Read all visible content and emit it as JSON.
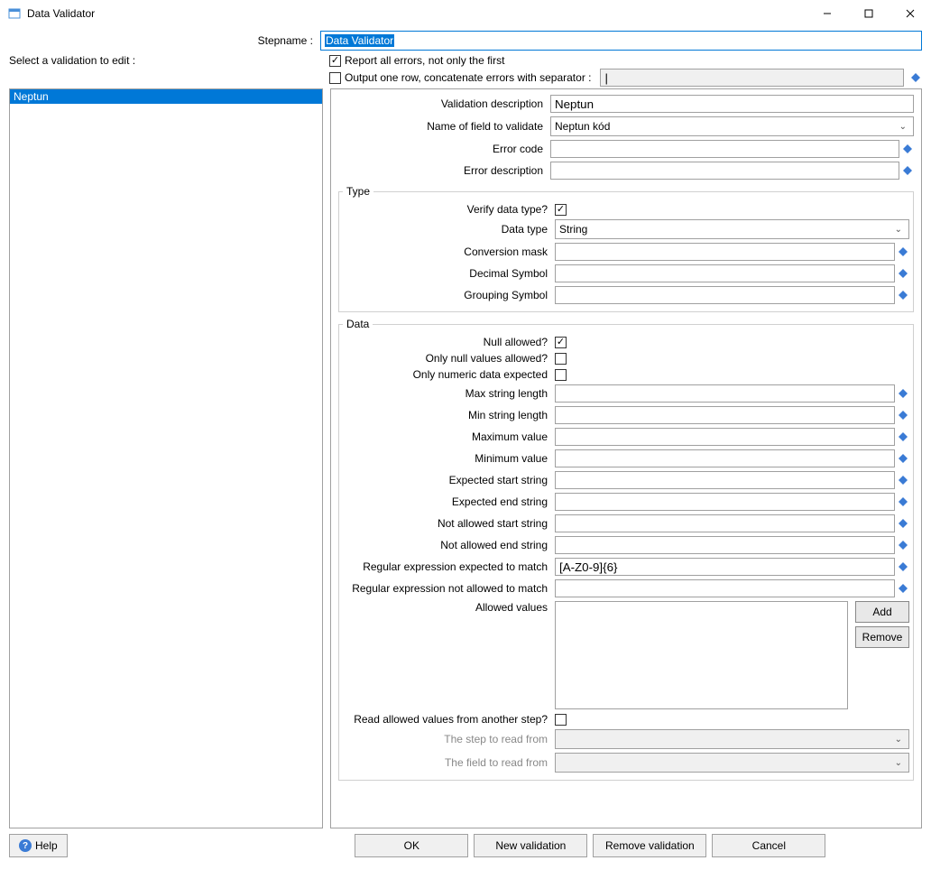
{
  "window": {
    "title": "Data Validator"
  },
  "header": {
    "stepname_label": "Stepname :",
    "stepname_value": "Data Validator",
    "select_label": "Select a validation to edit :",
    "report_all_label": "Report all errors, not only the first",
    "report_all_checked": true,
    "output_one_label": "Output one row, concatenate errors with separator :",
    "output_one_checked": false,
    "separator_value": "|"
  },
  "validations": {
    "items": [
      {
        "label": "Neptun",
        "selected": true
      }
    ]
  },
  "form": {
    "desc_label": "Validation description",
    "desc_value": "Neptun",
    "field_label": "Name of field to validate",
    "field_value": "Neptun kód",
    "errcode_label": "Error code",
    "errcode_value": "",
    "errdesc_label": "Error description",
    "errdesc_value": ""
  },
  "type_group": {
    "legend": "Type",
    "verify_label": "Verify data type?",
    "verify_checked": true,
    "dtype_label": "Data type",
    "dtype_value": "String",
    "convmask_label": "Conversion mask",
    "convmask_value": "",
    "decsym_label": "Decimal Symbol",
    "decsym_value": "",
    "grpsym_label": "Grouping Symbol",
    "grpsym_value": ""
  },
  "data_group": {
    "legend": "Data",
    "null_label": "Null allowed?",
    "null_checked": true,
    "onlynull_label": "Only null values allowed?",
    "onlynull_checked": false,
    "onlynum_label": "Only numeric data expected",
    "onlynum_checked": false,
    "maxlen_label": "Max string length",
    "maxlen_value": "",
    "minlen_label": "Min string length",
    "minlen_value": "",
    "maxval_label": "Maximum value",
    "maxval_value": "",
    "minval_label": "Minimum value",
    "minval_value": "",
    "expstart_label": "Expected start string",
    "expstart_value": "",
    "expend_label": "Expected end string",
    "expend_value": "",
    "notallowstart_label": "Not allowed start string",
    "notallowstart_value": "",
    "notallowend_label": "Not allowed end string",
    "notallowend_value": "",
    "regex_match_label": "Regular expression expected to match",
    "regex_match_value": "[A-Z0-9]{6}",
    "regex_not_label": "Regular expression not allowed to match",
    "regex_not_value": "",
    "allowed_label": "Allowed values",
    "add_btn": "Add",
    "remove_btn": "Remove",
    "readstep_label": "Read allowed values from another step?",
    "readstep_checked": false,
    "stepread_label": "The step to read from",
    "fieldread_label": "The field to read from"
  },
  "buttons": {
    "help": "Help",
    "ok": "OK",
    "new": "New validation",
    "remove": "Remove validation",
    "cancel": "Cancel"
  }
}
